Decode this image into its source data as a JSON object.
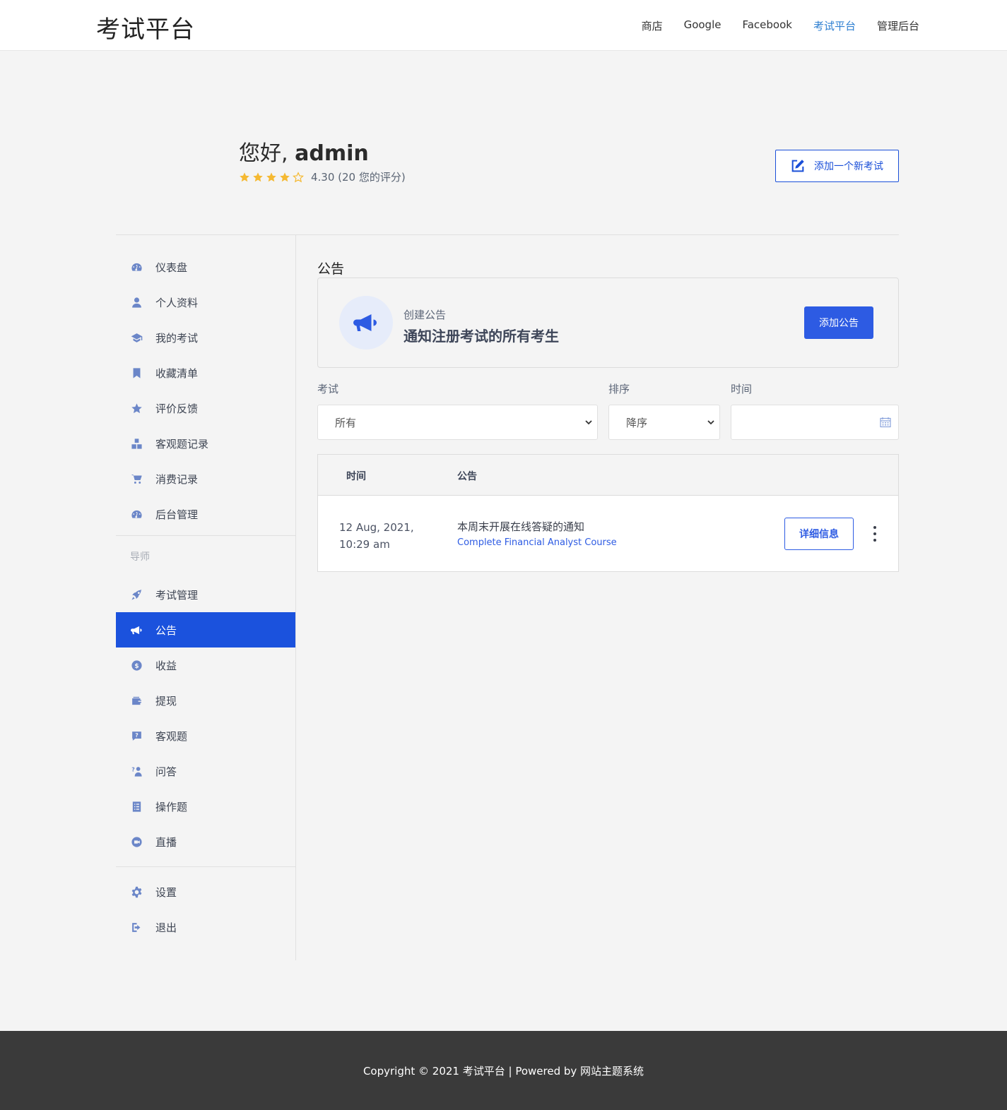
{
  "header": {
    "brand": "考试平台",
    "nav": [
      "商店",
      "Google",
      "Facebook",
      "考试平台",
      "管理后台"
    ]
  },
  "profile": {
    "greeting_prefix": "您好,",
    "username": "admin",
    "rating_text": "4.30 (20 您的评分)",
    "rating_value": 4.3,
    "add_exam_label": "添加一个新考试"
  },
  "sidebar": {
    "items": [
      {
        "label": "仪表盘",
        "icon": "dashboard-icon"
      },
      {
        "label": "个人资料",
        "icon": "user-icon"
      },
      {
        "label": "我的考试",
        "icon": "graduation-cap-icon"
      },
      {
        "label": "收藏清单",
        "icon": "bookmark-icon"
      },
      {
        "label": "评价反馈",
        "icon": "star-icon"
      },
      {
        "label": "客观题记录",
        "icon": "cubes-icon"
      },
      {
        "label": "消费记录",
        "icon": "cart-icon"
      },
      {
        "label": "后台管理",
        "icon": "dashboard-icon"
      }
    ],
    "mentor_heading": "导师",
    "mentor_items": [
      {
        "label": "考试管理",
        "icon": "rocket-icon"
      },
      {
        "label": "公告",
        "icon": "megaphone-icon"
      },
      {
        "label": "收益",
        "icon": "dollar-icon"
      },
      {
        "label": "提现",
        "icon": "wallet-icon"
      },
      {
        "label": "客观题",
        "icon": "question-icon"
      },
      {
        "label": "问答",
        "icon": "qa-icon"
      },
      {
        "label": "操作题",
        "icon": "list-icon"
      },
      {
        "label": "直播",
        "icon": "video-icon"
      }
    ],
    "bottom_items": [
      {
        "label": "设置",
        "icon": "gear-icon"
      },
      {
        "label": "退出",
        "icon": "logout-icon"
      }
    ]
  },
  "main": {
    "title": "公告",
    "create": {
      "subtitle": "创建公告",
      "headline": "通知注册考试的所有考生",
      "button": "添加公告"
    },
    "filters": {
      "exam_label": "考试",
      "exam_value": "所有",
      "order_label": "排序",
      "order_value": "降序",
      "time_label": "时间",
      "time_value": ""
    },
    "table": {
      "col_time": "时间",
      "col_notice": "公告",
      "rows": [
        {
          "date_line1": "12 Aug, 2021,",
          "date_line2": "10:29 am",
          "title": "本周末开展在线答疑的通知",
          "course": "Complete Financial Analyst Course",
          "button": "详细信息"
        }
      ]
    }
  },
  "footer": {
    "text": "Copyright © 2021 考试平台 | Powered by 网站主题系统"
  },
  "colors": {
    "accent": "#1b52dd",
    "primary_button": "#2d5be3",
    "star": "#f5b932",
    "footer_bg": "#3a3a3a"
  }
}
